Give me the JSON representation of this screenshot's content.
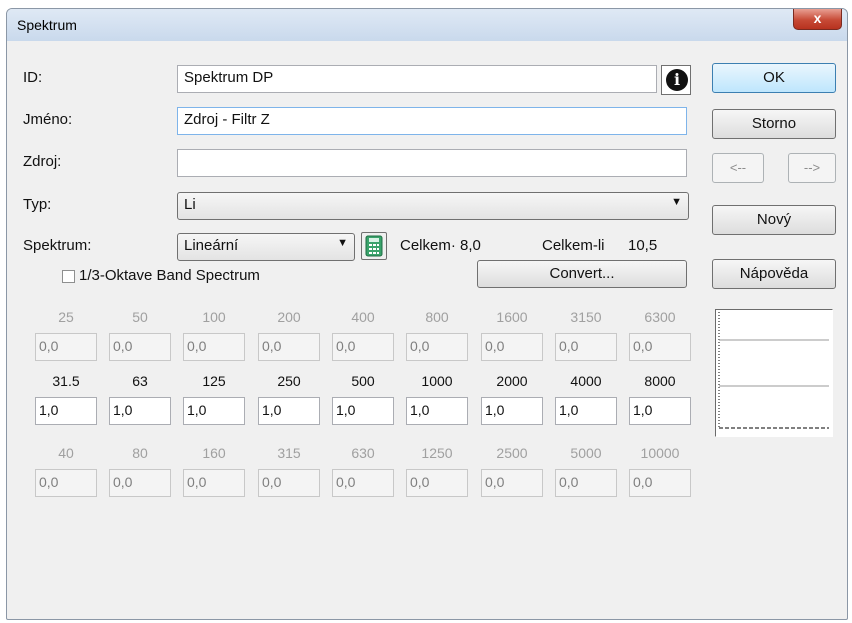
{
  "window": {
    "title": "Spektrum",
    "close_glyph": "x"
  },
  "fields": {
    "id_label": "ID:",
    "id_value": "Spektrum DP",
    "name_label": "Jméno:",
    "name_value": "Zdroj - Filtr Z",
    "source_label": "Zdroj:",
    "source_value": "",
    "type_label": "Typ:",
    "type_value": "Li",
    "spectrum_label": "Spektrum:",
    "spectrum_value": "Lineární",
    "total_label": "Celkem·",
    "total_value": "8,0",
    "total_li_label": "Celkem-li",
    "total_li_value": "10,5",
    "band_checkbox_label": "1/3-Oktave Band Spectrum",
    "band_checked": false
  },
  "buttons": {
    "ok": "OK",
    "cancel": "Storno",
    "prev": "<--",
    "next": "-->",
    "new": "Nový",
    "help": "Nápověda",
    "convert": "Convert..."
  },
  "grid": {
    "row1": {
      "headers": [
        "25",
        "50",
        "100",
        "200",
        "400",
        "800",
        "1600",
        "3150",
        "6300"
      ],
      "values": [
        "0,0",
        "0,0",
        "0,0",
        "0,0",
        "0,0",
        "0,0",
        "0,0",
        "0,0",
        "0,0"
      ]
    },
    "row2": {
      "headers": [
        "31.5",
        "63",
        "125",
        "250",
        "500",
        "1000",
        "2000",
        "4000",
        "8000"
      ],
      "values": [
        "1,0",
        "1,0",
        "1,0",
        "1,0",
        "1,0",
        "1,0",
        "1,0",
        "1,0",
        "1,0"
      ]
    },
    "row3": {
      "headers": [
        "40",
        "80",
        "160",
        "315",
        "630",
        "1250",
        "2500",
        "5000",
        "10000"
      ],
      "values": [
        "0,0",
        "0,0",
        "0,0",
        "0,0",
        "0,0",
        "0,0",
        "0,0",
        "0,0",
        "0,0"
      ]
    }
  },
  "colors": {
    "accent": "#3c7fb1",
    "close": "#c74a36",
    "background": "#f0f0f0"
  },
  "icons": [
    "info-icon",
    "calculator-icon",
    "close-icon",
    "dropdown-arrow-icon"
  ]
}
